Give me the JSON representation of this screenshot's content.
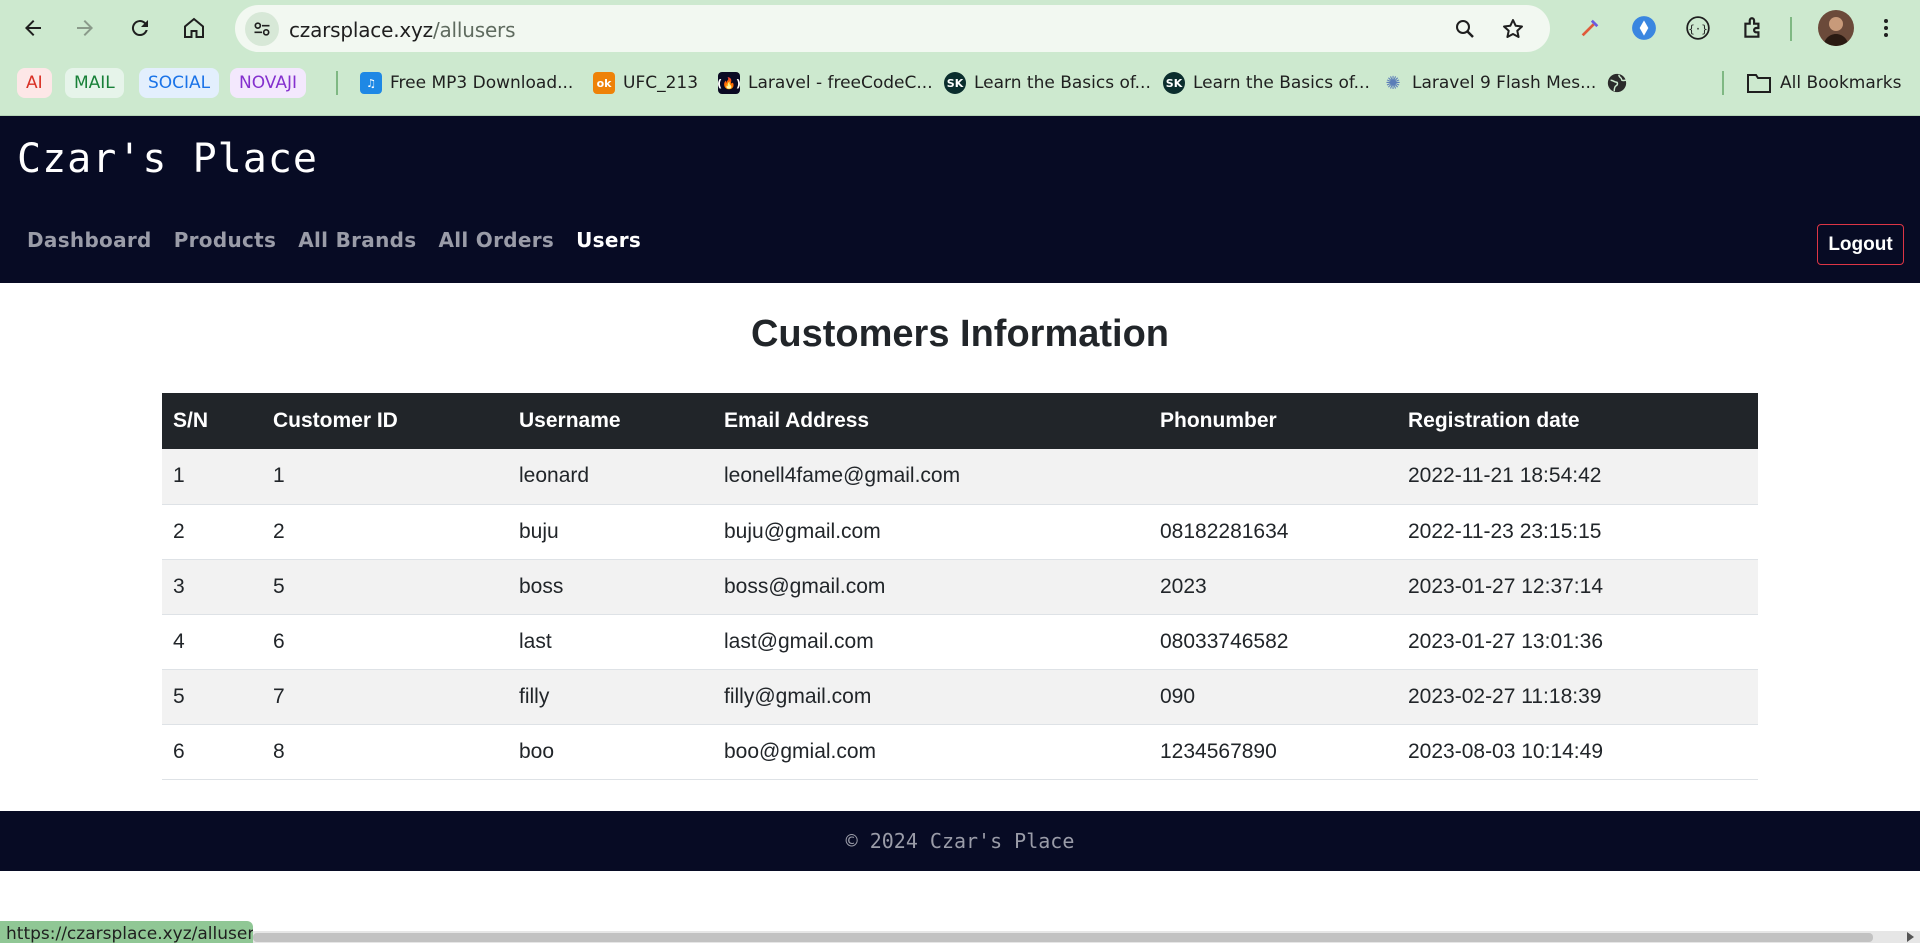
{
  "browser": {
    "url_domain": "czarsplace.xyz",
    "url_path": "/allusers",
    "bookmark_chips": [
      {
        "label": "AI",
        "color": "#d93025",
        "bg": "#fde7e7"
      },
      {
        "label": "MAIL",
        "color": "#188038",
        "bg": "#e6f4ea"
      },
      {
        "label": "SOCIAL",
        "color": "#1a73e8",
        "bg": "#e3effd"
      },
      {
        "label": "NOVAJI",
        "color": "#8430ce",
        "bg": "#f3e8fd"
      }
    ],
    "bookmarks": [
      {
        "label": "Free MP3 Download...",
        "icon": "music-note-icon",
        "icon_color": "#1e88e5"
      },
      {
        "label": "UFC_213",
        "icon": "ok-ru-icon",
        "icon_color": "#ee8208"
      },
      {
        "label": "Laravel - freeCodeC...",
        "icon": "freecodecamp-icon",
        "icon_color": "#0a0a23"
      },
      {
        "label": "Learn the Basics of...",
        "icon": "sk-icon",
        "icon_color": "#0b2e2e"
      },
      {
        "label": "Learn the Basics of...",
        "icon": "sk-icon",
        "icon_color": "#0b2e2e"
      },
      {
        "label": "Laravel 9 Flash Mes...",
        "icon": "lightbulb-icon",
        "icon_color": "#5b7db8"
      }
    ],
    "all_bookmarks_label": "All Bookmarks",
    "status_url": "https://czarsplace.xyz/allusers"
  },
  "site": {
    "brand": "Czar's Place",
    "nav": [
      "Dashboard",
      "Products",
      "All Brands",
      "All Orders",
      "Users"
    ],
    "active_nav": "Users",
    "logout_label": "Logout",
    "logout_border_color": "#dc3545",
    "navbar_color": "#070b24"
  },
  "page": {
    "heading": "Customers Information",
    "columns": [
      "S/N",
      "Customer ID",
      "Username",
      "Email Address",
      "Phonumber",
      "Registration date"
    ],
    "rows": [
      [
        "1",
        "1",
        "leonard",
        "leonell4fame@gmail.com",
        "",
        "2022-11-21 18:54:42"
      ],
      [
        "2",
        "2",
        "buju",
        "buju@gmail.com",
        "08182281634",
        "2022-11-23 23:15:15"
      ],
      [
        "3",
        "5",
        "boss",
        "boss@gmail.com",
        "2023",
        "2023-01-27 12:37:14"
      ],
      [
        "4",
        "6",
        "last",
        "last@gmail.com",
        "08033746582",
        "2023-01-27 13:01:36"
      ],
      [
        "5",
        "7",
        "filly",
        "filly@gmail.com",
        "090",
        "2023-02-27 11:18:39"
      ],
      [
        "6",
        "8",
        "boo",
        "boo@gmial.com",
        "1234567890",
        "2023-08-03 10:14:49"
      ]
    ]
  },
  "footer": {
    "text": "© 2024 Czar's Place"
  }
}
